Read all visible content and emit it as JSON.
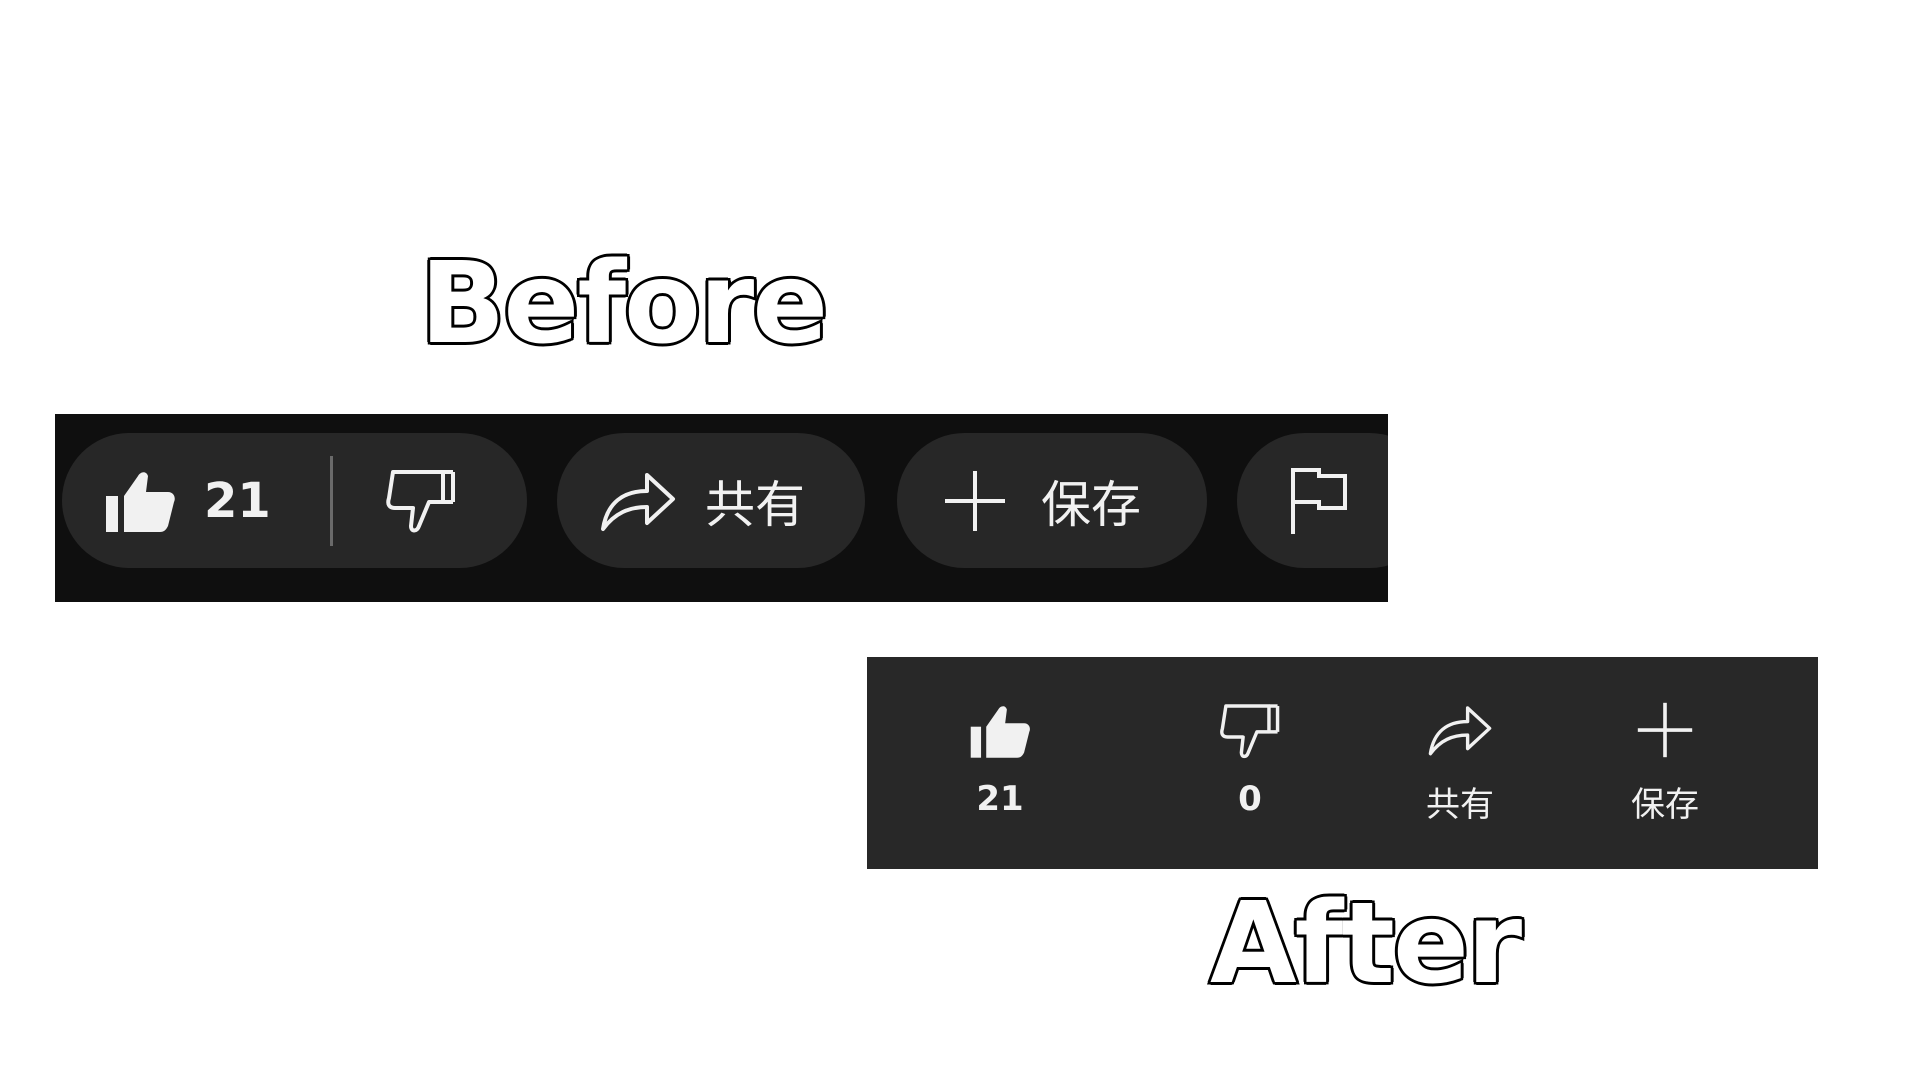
{
  "headings": {
    "before": "Before",
    "after": "After"
  },
  "before_toolbar": {
    "like_count": "21",
    "share_label": "共有",
    "save_label": "保存",
    "icons": {
      "like": "thumbs-up-filled-icon",
      "dislike": "thumbs-down-outline-icon",
      "share": "share-arrow-icon",
      "save": "plus-icon",
      "report": "flag-icon"
    }
  },
  "after_toolbar": {
    "like_count": "21",
    "dislike_count": "0",
    "share_label": "共有",
    "save_label": "保存",
    "icons": {
      "like": "thumbs-up-filled-icon",
      "dislike": "thumbs-down-outline-icon",
      "share": "share-arrow-icon",
      "save": "plus-icon"
    }
  },
  "colors": {
    "before_background": "#0f0f0f",
    "before_pill": "#272727",
    "after_background": "#282828",
    "foreground": "#f1f1f1",
    "page_background": "#ffffff"
  }
}
